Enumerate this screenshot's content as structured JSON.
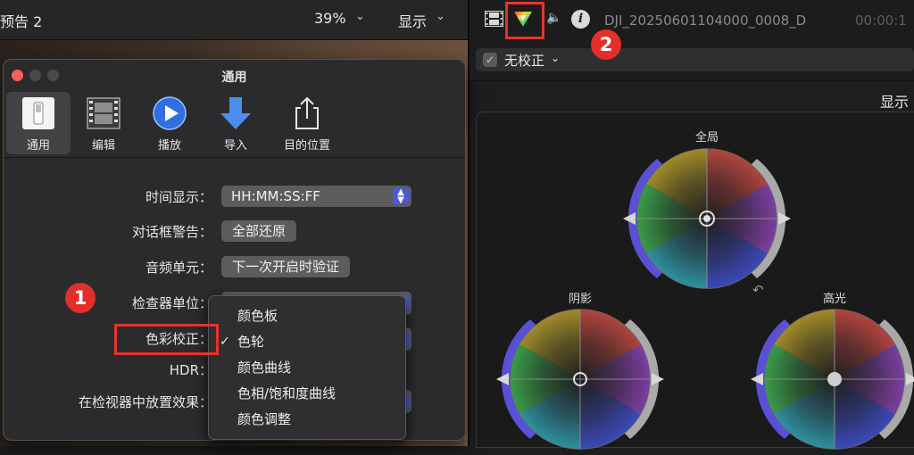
{
  "left_viewer": {
    "title": "预告 2",
    "zoom": "39%",
    "display_label": "显示"
  },
  "dialog": {
    "title": "通用",
    "toolbar": [
      {
        "label": "通用",
        "icon": "general-switch-icon",
        "selected": true
      },
      {
        "label": "编辑",
        "icon": "film-strip-icon"
      },
      {
        "label": "播放",
        "icon": "play-icon"
      },
      {
        "label": "导入",
        "icon": "import-arrow-icon"
      },
      {
        "label": "目的位置",
        "icon": "share-icon"
      }
    ],
    "rows": {
      "time_display_label": "时间显示：",
      "time_display_value": "HH:MM:SS:FF",
      "dialog_warning_label": "对话框警告：",
      "dialog_warning_button": "全部还原",
      "audio_units_label": "音频单元：",
      "audio_units_button": "下一次开启时验证",
      "inspector_units_label": "检查器单位：",
      "color_correction_label": "色彩校正：",
      "hdr_label": "HDR：",
      "effects_label": "在检视器中放置效果："
    },
    "color_menu": {
      "items": [
        "颜色板",
        "色轮",
        "颜色曲线",
        "色相/饱和度曲线",
        "颜色调整"
      ],
      "selected": "色轮"
    }
  },
  "annotations": {
    "badge_1": "1",
    "badge_2": "2",
    "highlight_color": "#e8322d"
  },
  "inspector": {
    "clip_name": "DJI_20250601104000_0008_D",
    "timecode": "00:00:1",
    "icons": [
      "film-icon",
      "color-prism-icon",
      "speaker-icon",
      "info-icon"
    ],
    "correction_label": "无校正",
    "display_label": "显示",
    "wheels": {
      "global": "全局",
      "shadows": "阴影",
      "highlights": "高光"
    }
  }
}
